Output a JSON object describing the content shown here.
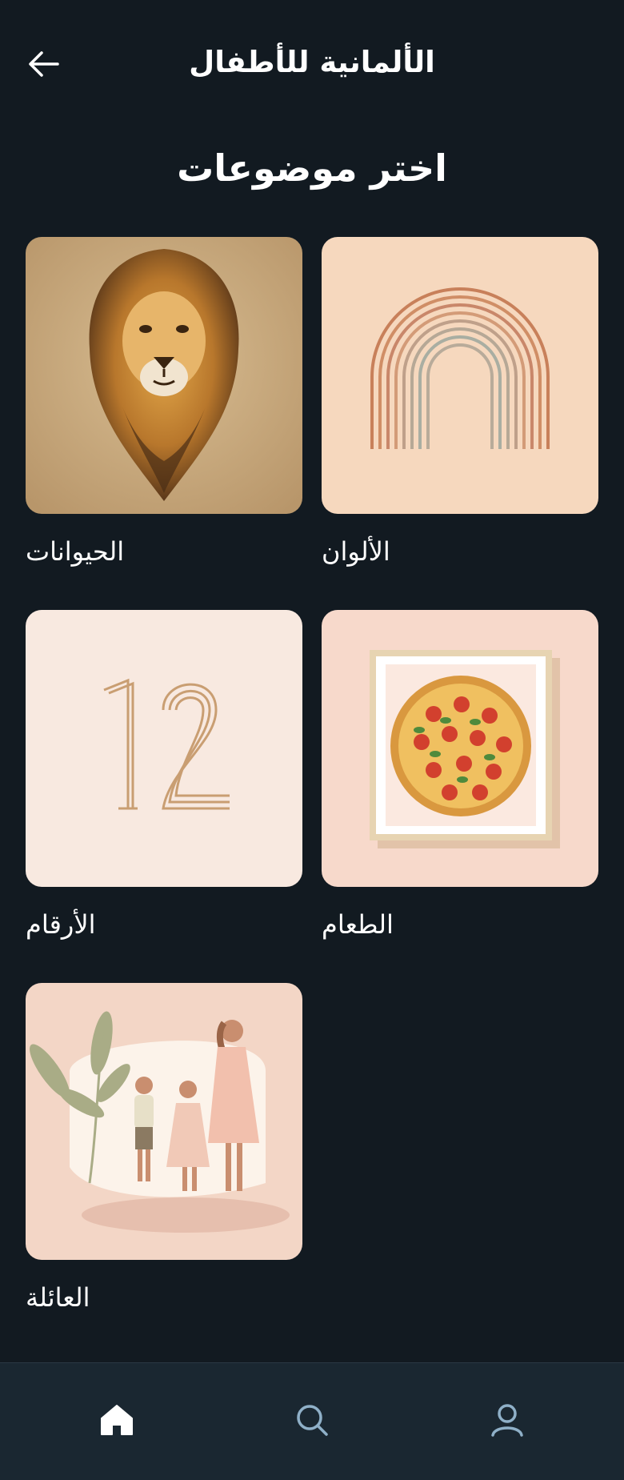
{
  "header": {
    "title": "الألمانية للأطفال",
    "back_icon": "arrow-left-icon"
  },
  "page": {
    "title": "اختر موضوعات"
  },
  "topics": [
    {
      "label": "الحيوانات",
      "image": "lion-illustration"
    },
    {
      "label": "الألوان",
      "image": "rainbow-illustration"
    },
    {
      "label": "الأرقام",
      "image": "number-12-illustration"
    },
    {
      "label": "الطعام",
      "image": "pizza-illustration"
    },
    {
      "label": "العائلة",
      "image": "family-illustration"
    }
  ],
  "nav": {
    "items": [
      "home-icon",
      "search-icon",
      "profile-icon"
    ],
    "active": "home-icon"
  },
  "colors": {
    "background": "#121a21",
    "nav_background": "#1a2731",
    "nav_icon": "#8fb0c8"
  }
}
